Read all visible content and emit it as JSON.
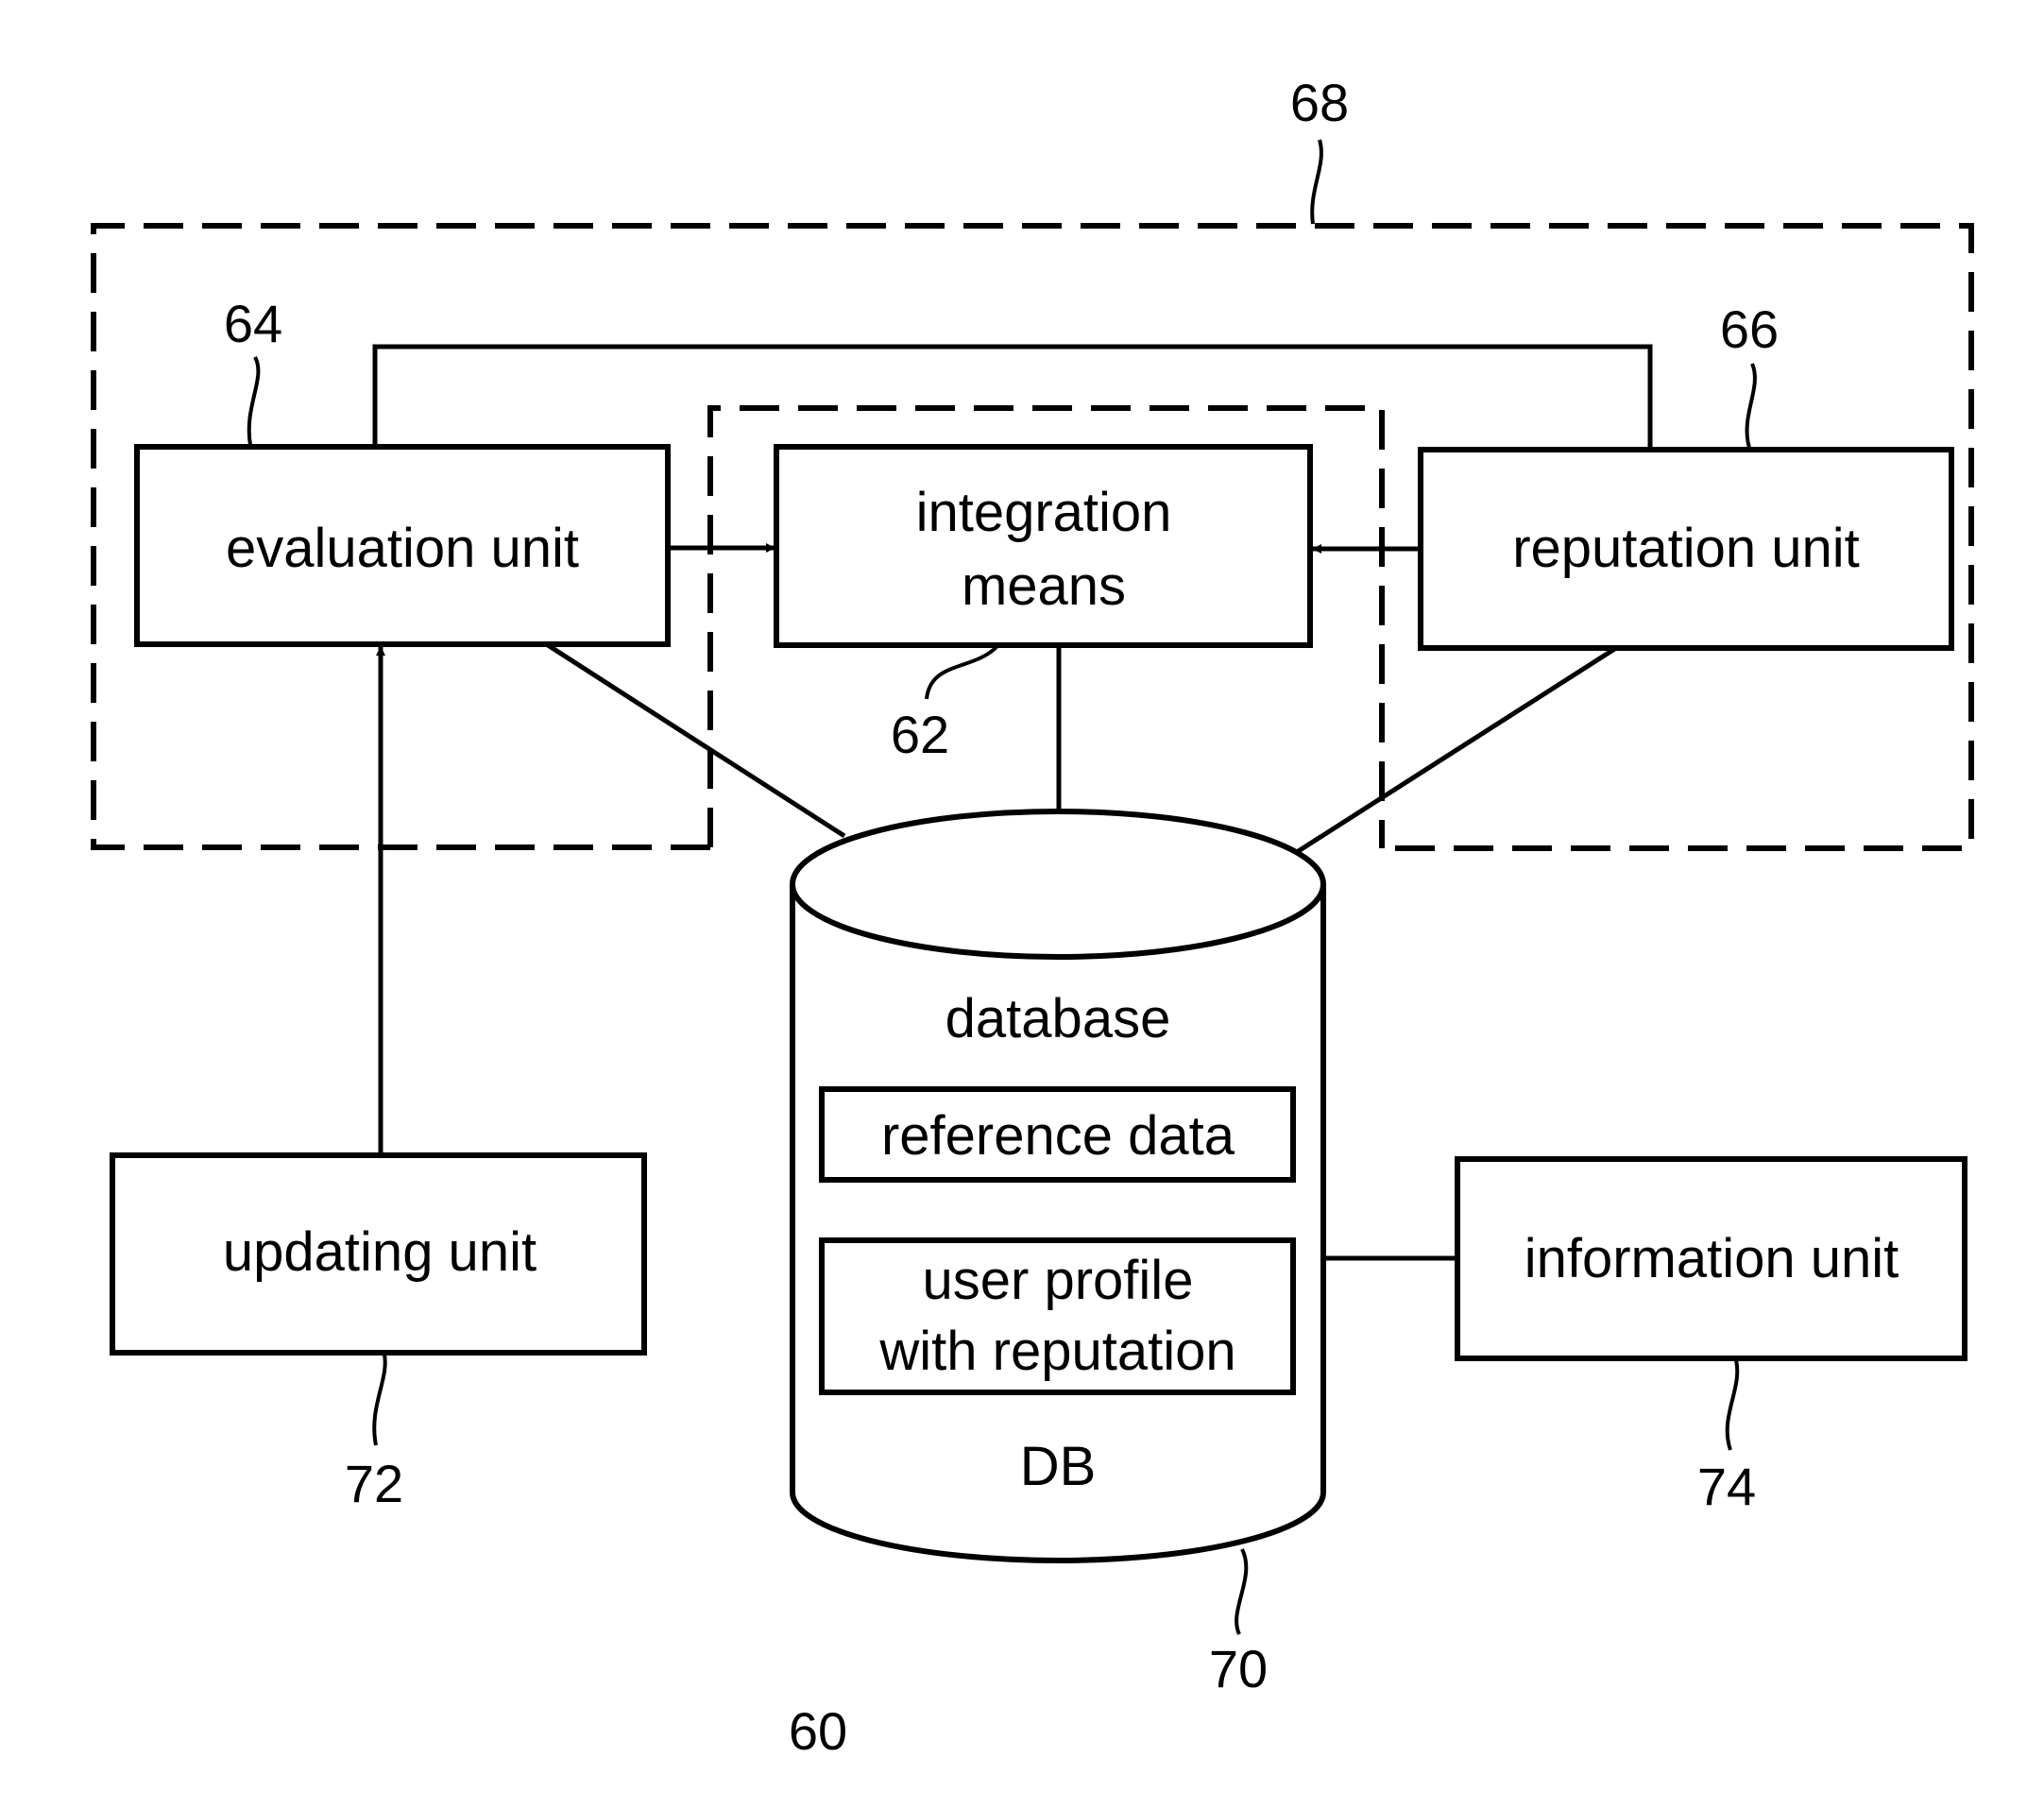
{
  "figure": {
    "number": "60",
    "groups": {
      "outer": {
        "ref": "68"
      },
      "inner": {
        "ref": "62"
      }
    },
    "components": {
      "evaluation": {
        "label": "evaluation unit",
        "ref": "64"
      },
      "integration": {
        "label_line1": "integration",
        "label_line2": "means",
        "ref": "62"
      },
      "reputation": {
        "label": "reputation unit",
        "ref": "66"
      },
      "updating": {
        "label": "updating unit",
        "ref": "72"
      },
      "information": {
        "label": "information unit",
        "ref": "74"
      },
      "database": {
        "title": "database",
        "footer": "DB",
        "ref": "70",
        "entries": [
          {
            "line1": "reference data"
          },
          {
            "line1": "user profile",
            "line2": "with reputation"
          }
        ]
      }
    },
    "connections": [
      {
        "from": "evaluation unit",
        "to": "integration means",
        "type": "arrow"
      },
      {
        "from": "reputation unit",
        "to": "integration means",
        "type": "arrow"
      },
      {
        "from": "updating unit",
        "to": "evaluation unit",
        "type": "arrow"
      },
      {
        "from": "evaluation unit",
        "to": "reputation unit",
        "type": "line"
      },
      {
        "from": "evaluation unit",
        "to": "database",
        "type": "line"
      },
      {
        "from": "integration means",
        "to": "database",
        "type": "line"
      },
      {
        "from": "reputation unit",
        "to": "database",
        "type": "line"
      },
      {
        "from": "database",
        "to": "information unit",
        "type": "line"
      }
    ]
  }
}
